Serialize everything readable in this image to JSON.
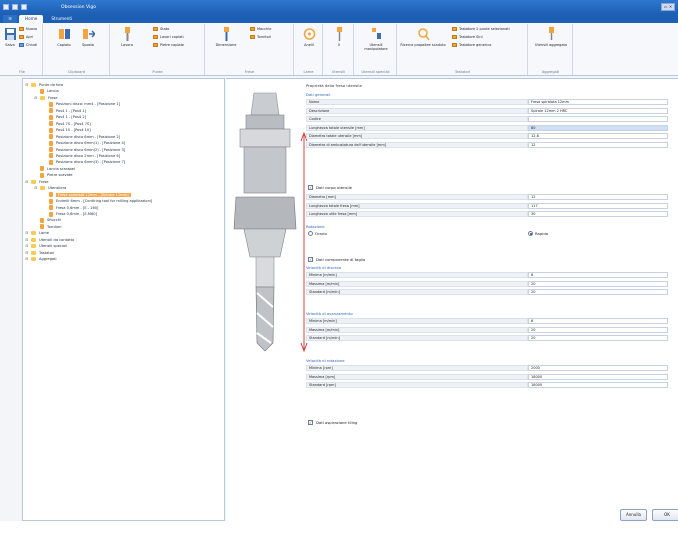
{
  "window": {
    "title": "Obsession Vigo",
    "app_icon": "app-logo-icon"
  },
  "tabs": {
    "file": "",
    "items": [
      {
        "label": "Home"
      },
      {
        "label": "Strumenti"
      }
    ]
  },
  "ribbon": {
    "groups": [
      {
        "label": "File",
        "buttons": [
          "Salva",
          "Nuovo",
          "Apri",
          "Chiudi"
        ]
      },
      {
        "label": "Clipboard",
        "buttons": [
          "Copiato",
          "Sposta"
        ]
      },
      {
        "label": "Punte",
        "buttons": [
          "Lavoro",
          "Stato",
          "Lavori copiati",
          "Pietre copiate"
        ]
      },
      {
        "label": "Frese",
        "buttons": [
          "Dimensione",
          "Macchie",
          "Tornitori"
        ]
      },
      {
        "label": "Lame",
        "buttons": [
          "Anelli"
        ]
      },
      {
        "label": "Utensili",
        "buttons": [
          "Il",
          "Stato"
        ]
      },
      {
        "label": "Utensili speciali",
        "buttons": [
          "Utensili manipolatore"
        ]
      },
      {
        "label": "Tastatori",
        "buttons": [
          "Ricerca propaliee scaduto",
          "Tastatore 2 punte selezionati",
          "Tastatore Sini",
          "Tastatore generico"
        ]
      },
      {
        "label": "Aggregati",
        "buttons": [
          "Utensili aggregato"
        ]
      }
    ]
  },
  "tree": [
    {
      "label": "Punte da foro",
      "level": 0,
      "icon": "folder"
    },
    {
      "label": "Lancia",
      "level": 1,
      "icon": "drill"
    },
    {
      "label": "Frese",
      "level": 1,
      "icon": "folder"
    },
    {
      "label": "Posizioni disco: mm4 - [Posizione 1]",
      "level": 2,
      "icon": "drill"
    },
    {
      "label": "Pos4 1 - [Pos4 1]",
      "level": 2,
      "icon": "drill"
    },
    {
      "label": "Pos4 1 - [Pos4 2]",
      "level": 2,
      "icon": "drill"
    },
    {
      "label": "Pos4 7S - [Pos4 7S]",
      "level": 2,
      "icon": "drill"
    },
    {
      "label": "Pos4 10 - [Pos4 10]",
      "level": 2,
      "icon": "drill"
    },
    {
      "label": "Posizione disco 6mm - [Posizione 2]",
      "level": 2,
      "icon": "drill"
    },
    {
      "label": "Posizione disco 6mm(1) - [Posizione 4]",
      "level": 2,
      "icon": "drill"
    },
    {
      "label": "Posizione disco 6mm(2) - [Posizione 3]",
      "level": 2,
      "icon": "drill"
    },
    {
      "label": "Posizione disco 2mm - [Posizione 6]",
      "level": 2,
      "icon": "drill"
    },
    {
      "label": "Posizione disco 6mm(3) - [Posizione 7]",
      "level": 2,
      "icon": "drill"
    },
    {
      "label": "Lancia scarabei",
      "level": 1,
      "icon": "drill"
    },
    {
      "label": "Pietre scavate",
      "level": 1,
      "icon": "drill"
    },
    {
      "label": "Frese",
      "level": 0,
      "icon": "folder"
    },
    {
      "label": "Utensilera",
      "level": 1,
      "icon": "folder"
    },
    {
      "label": "Fresa spiralata 12mm - [Spirale 12mm]",
      "level": 2,
      "icon": "drill",
      "selected": true
    },
    {
      "label": "Endmill 6mm - [Contiring tool for milling applikazioni]",
      "level": 2,
      "icon": "drill"
    },
    {
      "label": "Fresa 0,6mm - [E - 160]",
      "level": 2,
      "icon": "drill"
    },
    {
      "label": "Fresa 0,6mm - [E-M60]",
      "level": 2,
      "icon": "drill"
    },
    {
      "label": "Sfiocchi",
      "level": 1,
      "icon": "drill"
    },
    {
      "label": "Tornitori",
      "level": 1,
      "icon": "drill"
    },
    {
      "label": "Lame",
      "level": 0,
      "icon": "folder"
    },
    {
      "label": "Utensili da contatto",
      "level": 0,
      "icon": "folder"
    },
    {
      "label": "Utensili speciali",
      "level": 0,
      "icon": "folder"
    },
    {
      "label": "Tastatori",
      "level": 0,
      "icon": "folder"
    },
    {
      "label": "Aggregati",
      "level": 0,
      "icon": "folder"
    }
  ],
  "properties": {
    "title": "Proprietà della fresa utensile",
    "general_section": "Dati generali",
    "general": [
      {
        "label": "Nome",
        "value": "Fresa spiralata 12mm"
      },
      {
        "label": "Descrizione",
        "value": "Spirale 12mm 2 HRC"
      },
      {
        "label": "Codice",
        "value": ""
      },
      {
        "label": "Lunghezza totale utensile [mm]",
        "value": "80",
        "hl": true
      },
      {
        "label": "Diametro totale utensile [mm]",
        "value": "12,8"
      },
      {
        "label": "Diametro di ambustatura dell'utensile [mm]",
        "value": "12"
      }
    ],
    "cut_check": "Dati corpo utensile",
    "cut": [
      {
        "label": "Diametro [mm]",
        "value": "12"
      },
      {
        "label": "Lunghezza totale fresa [mm]",
        "value": "117"
      },
      {
        "label": "Lunghezza utile fresa [mm]",
        "value": "30"
      }
    ],
    "rotation_section": "Rotazione",
    "rotation_options": [
      {
        "label": "Orario",
        "on": false
      },
      {
        "label": "Rapida",
        "on": true
      }
    ],
    "params_check": "Dati componente di taglio",
    "speed_section": "Velocità di discesa",
    "speed": [
      {
        "label": "Minima [m/min]",
        "value": "6"
      },
      {
        "label": "Massima [m/min]",
        "value": "20"
      },
      {
        "label": "Standard [m/min]",
        "value": "20"
      }
    ],
    "feed_section": "Velocità di avanzamento",
    "feed": [
      {
        "label": "Minima [m/min]",
        "value": "6"
      },
      {
        "label": "Massima [m/min]",
        "value": "20"
      },
      {
        "label": "Standard [m/min]",
        "value": "20"
      }
    ],
    "rot_section": "Velocità di rotazione",
    "rot": [
      {
        "label": "Minima [rpm]",
        "value": "2000"
      },
      {
        "label": "Massima [rpm]",
        "value": "18000"
      },
      {
        "label": "Standard [rpm]",
        "value": "18000"
      }
    ],
    "extra_check": "Dati aspirazione tiling"
  },
  "footer": {
    "ok_label": "Annulla",
    "next_label": "OK"
  },
  "colors": {
    "accent": "#1d5fb5",
    "selected": "#f7a64a",
    "dimension_arrow": "#d22c2c"
  }
}
